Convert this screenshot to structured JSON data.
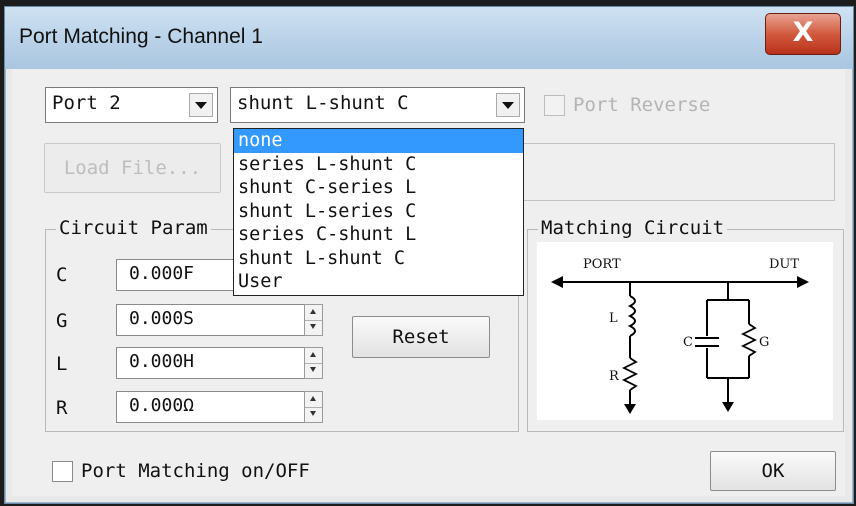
{
  "window": {
    "title": "Port Matching - Channel 1",
    "close_glyph": "X"
  },
  "port_select": {
    "value": "Port 2"
  },
  "circuit_select": {
    "value": "shunt L-shunt C",
    "options": [
      "none",
      "series L-shunt C",
      "shunt C-series L",
      "shunt L-series C",
      "series C-shunt L",
      "shunt L-shunt C",
      "User"
    ],
    "highlighted": "none"
  },
  "port_reverse": {
    "label": "Port Reverse",
    "checked": false,
    "enabled": false
  },
  "load_file": {
    "label": "Load File..."
  },
  "circuit_params": {
    "title": "Circuit Param",
    "rows": [
      {
        "name": "C",
        "value": "0.000F"
      },
      {
        "name": "G",
        "value": "0.000S"
      },
      {
        "name": "L",
        "value": "0.000H"
      },
      {
        "name": "R",
        "value": "0.000Ω"
      }
    ],
    "reset_label": "Reset"
  },
  "matching_circuit": {
    "title": "Matching Circuit",
    "labels": {
      "port": "PORT",
      "dut": "DUT",
      "l": "L",
      "r": "R",
      "c": "C",
      "g": "G"
    }
  },
  "port_matching": {
    "label": "Port Matching on/OFF",
    "checked": false
  },
  "ok": {
    "label": "OK"
  },
  "colors": {
    "title_bar": "#b9d1e8",
    "close_button": "#d25a3f",
    "selection": "#3399ff",
    "dialog_bg": "#efefef"
  }
}
